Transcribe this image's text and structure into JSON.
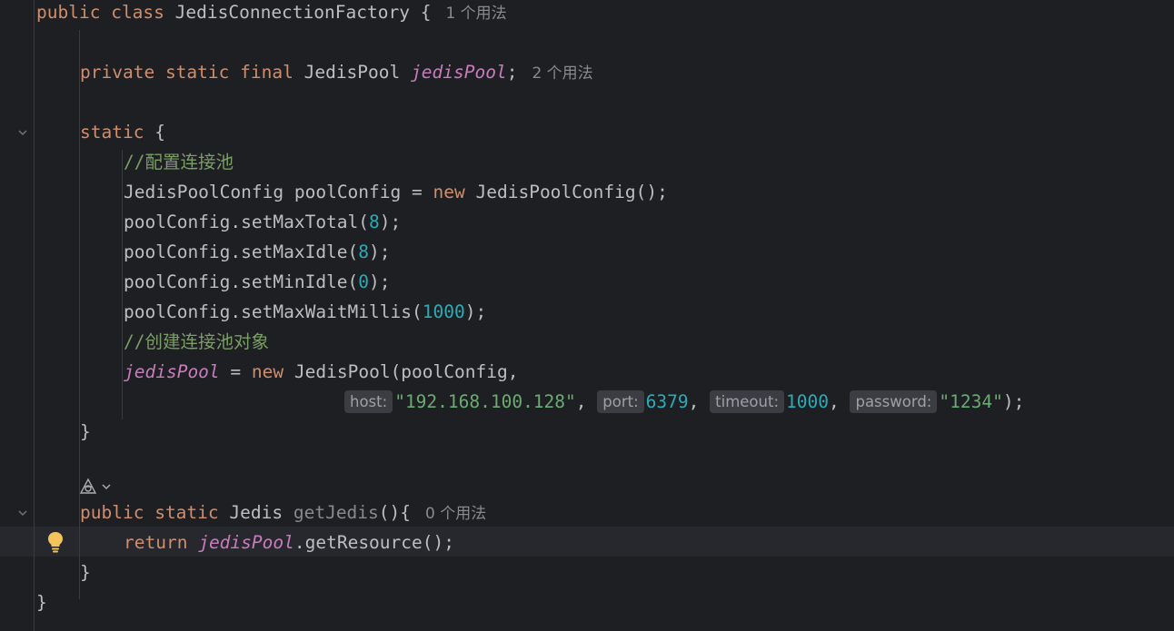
{
  "code": {
    "class_decl": {
      "kw1": "public",
      "kw2": "class",
      "name": "JedisConnectionFactory",
      "brace": "{",
      "usages": "1 个用法"
    },
    "field_decl": {
      "kw1": "private",
      "kw2": "static",
      "kw3": "final",
      "type": "JedisPool",
      "name": "jedisPool",
      "semi": ";",
      "usages": "2 个用法"
    },
    "static_block": {
      "kw": "static",
      "brace": "{"
    },
    "comment1": "//配置连接池",
    "config_decl": {
      "type": "JedisPoolConfig",
      "var": "poolConfig",
      "eq": "=",
      "kw": "new",
      "ctor": "JedisPoolConfig",
      "end": "();"
    },
    "calls": [
      {
        "prefix": "poolConfig.setMaxTotal(",
        "arg": "8",
        "suffix": ");"
      },
      {
        "prefix": "poolConfig.setMaxIdle(",
        "arg": "8",
        "suffix": ");"
      },
      {
        "prefix": "poolConfig.setMinIdle(",
        "arg": "0",
        "suffix": ");"
      },
      {
        "prefix": "poolConfig.setMaxWaitMillis(",
        "arg": "1000",
        "suffix": ");"
      }
    ],
    "comment2": "//创建连接池对象",
    "assign": {
      "field": "jedisPool",
      "eq": "=",
      "kw": "new",
      "rest": "JedisPool(poolConfig,"
    },
    "args": {
      "host_hint": "host:",
      "host_val": "\"192.168.100.128\"",
      "port_hint": "port:",
      "port_val": "6379",
      "timeout_hint": "timeout:",
      "timeout_val": "1000",
      "password_hint": "password:",
      "password_val": "\"1234\"",
      "comma": ",",
      "end": ");"
    },
    "close_brace": "}",
    "method_decl": {
      "kw1": "public",
      "kw2": "static",
      "type": "Jedis",
      "name": "getJedis",
      "rest": "(){",
      "usages": "0 个用法"
    },
    "return_stmt": {
      "kw": "return",
      "field": "jedisPool",
      "rest": ".getResource();"
    },
    "method_close": "}",
    "class_close": "}"
  },
  "colors": {
    "background": "#1e1f22",
    "keyword": "#cf8e6d",
    "number": "#2aacb8",
    "string": "#6aab73",
    "comment": "#7a9e65",
    "field": "#c77dbb",
    "text": "#bcbec4"
  },
  "icons": {
    "fold": "chevron-down-icon",
    "bulb": "lightbulb-icon",
    "ai": "ai-assistant-icon"
  }
}
